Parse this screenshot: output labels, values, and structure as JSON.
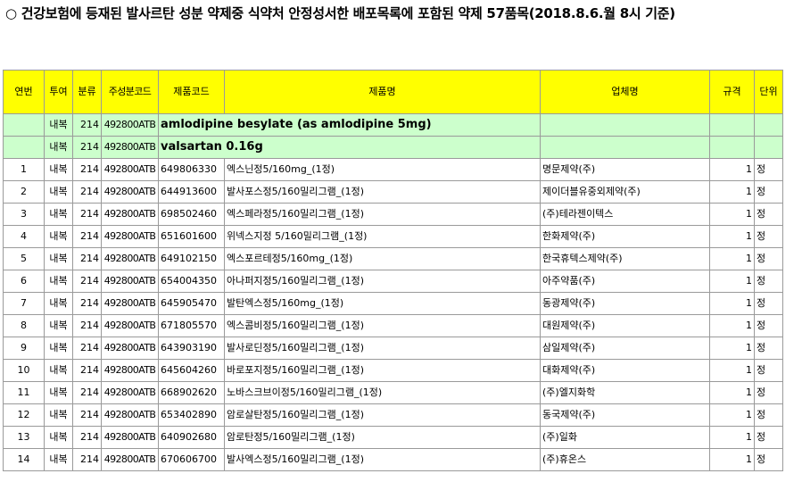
{
  "title": "○ 건강보험에 등재된 발사르탄 성분 약제중 식약처 안정성서한 배포목록에 포함된 약제 57품목(2018.8.6.월 8시 기준)",
  "headers": {
    "no": "연번",
    "route": "투여",
    "class": "분류",
    "ingredient": "주성분코드",
    "product_code": "제품코드",
    "product_name": "제품명",
    "company": "업체명",
    "spec": "규격",
    "unit": "단위"
  },
  "ingredients": [
    {
      "route": "내복",
      "class": "214",
      "code": "492800ATB",
      "name": "amlodipine besylate (as amlodipine   5mg)"
    },
    {
      "route": "내복",
      "class": "214",
      "code": "492800ATB",
      "name": "valsartan   0.16g"
    }
  ],
  "rows": [
    {
      "no": "1",
      "route": "내복",
      "class": "214",
      "ingredient": "492800ATB",
      "product_code": "649806330",
      "product_name": "엑스닌정5/160mg_(1정)",
      "company": "명문제약(주)",
      "spec": "1",
      "unit": "정"
    },
    {
      "no": "2",
      "route": "내복",
      "class": "214",
      "ingredient": "492800ATB",
      "product_code": "644913600",
      "product_name": "발사포스정5/160밀리그램_(1정)",
      "company": "제이더블유중외제약(주)",
      "spec": "1",
      "unit": "정"
    },
    {
      "no": "3",
      "route": "내복",
      "class": "214",
      "ingredient": "492800ATB",
      "product_code": "698502460",
      "product_name": "엑스페라정5/160밀리그램_(1정)",
      "company": "(주)테라젠이텍스",
      "spec": "1",
      "unit": "정"
    },
    {
      "no": "4",
      "route": "내복",
      "class": "214",
      "ingredient": "492800ATB",
      "product_code": "651601600",
      "product_name": "위넥스지정 5/160밀리그램_(1정)",
      "company": "한화제약(주)",
      "spec": "1",
      "unit": "정"
    },
    {
      "no": "5",
      "route": "내복",
      "class": "214",
      "ingredient": "492800ATB",
      "product_code": "649102150",
      "product_name": "엑스포르테정5/160mg_(1정)",
      "company": "한국휴텍스제약(주)",
      "spec": "1",
      "unit": "정"
    },
    {
      "no": "6",
      "route": "내복",
      "class": "214",
      "ingredient": "492800ATB",
      "product_code": "654004350",
      "product_name": "아나퍼지정5/160밀리그램_(1정)",
      "company": "아주약품(주)",
      "spec": "1",
      "unit": "정"
    },
    {
      "no": "7",
      "route": "내복",
      "class": "214",
      "ingredient": "492800ATB",
      "product_code": "645905470",
      "product_name": "발탄엑스정5/160mg_(1정)",
      "company": "동광제약(주)",
      "spec": "1",
      "unit": "정"
    },
    {
      "no": "8",
      "route": "내복",
      "class": "214",
      "ingredient": "492800ATB",
      "product_code": "671805570",
      "product_name": "엑스콤비정5/160밀리그램_(1정)",
      "company": "대원제약(주)",
      "spec": "1",
      "unit": "정"
    },
    {
      "no": "9",
      "route": "내복",
      "class": "214",
      "ingredient": "492800ATB",
      "product_code": "643903190",
      "product_name": "발사로딘정5/160밀리그램_(1정)",
      "company": "삼일제약(주)",
      "spec": "1",
      "unit": "정"
    },
    {
      "no": "10",
      "route": "내복",
      "class": "214",
      "ingredient": "492800ATB",
      "product_code": "645604260",
      "product_name": "바로포지정5/160밀리그램_(1정)",
      "company": "대화제약(주)",
      "spec": "1",
      "unit": "정"
    },
    {
      "no": "11",
      "route": "내복",
      "class": "214",
      "ingredient": "492800ATB",
      "product_code": "668902620",
      "product_name": "노바스크브이정5/160밀리그램_(1정)",
      "company": "(주)엘지화학",
      "spec": "1",
      "unit": "정"
    },
    {
      "no": "12",
      "route": "내복",
      "class": "214",
      "ingredient": "492800ATB",
      "product_code": "653402890",
      "product_name": "암로살탄정5/160밀리그램_(1정)",
      "company": "동국제약(주)",
      "spec": "1",
      "unit": "정"
    },
    {
      "no": "13",
      "route": "내복",
      "class": "214",
      "ingredient": "492800ATB",
      "product_code": "640902680",
      "product_name": "암로탄정5/160밀리그램_(1정)",
      "company": "(주)일화",
      "spec": "1",
      "unit": "정"
    },
    {
      "no": "14",
      "route": "내복",
      "class": "214",
      "ingredient": "492800ATB",
      "product_code": "670606700",
      "product_name": "발사엑스정5/160밀리그램_(1정)",
      "company": "(주)휴온스",
      "spec": "1",
      "unit": "정"
    }
  ]
}
